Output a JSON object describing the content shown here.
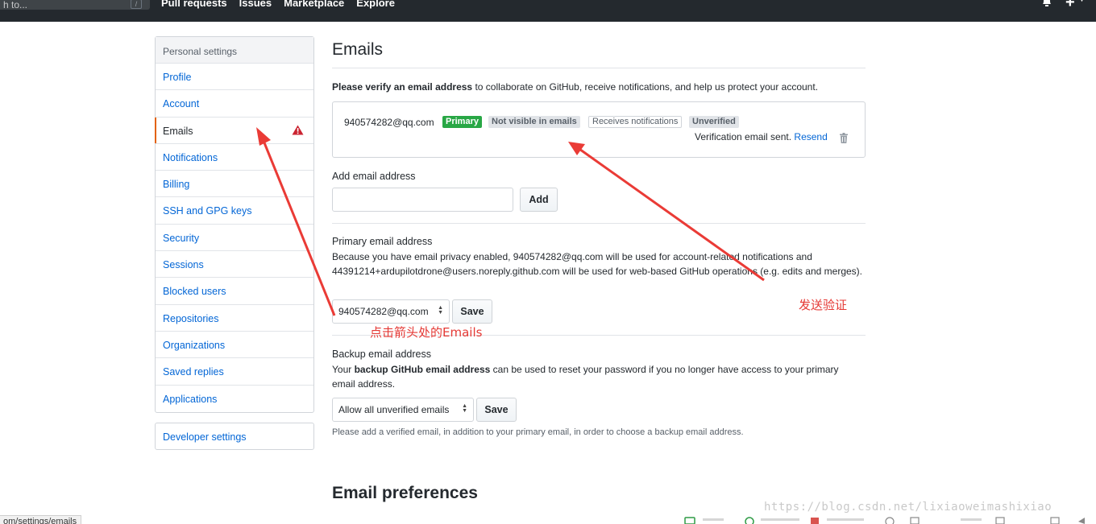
{
  "header": {
    "search_placeholder": "h to...",
    "slash_key": "/",
    "nav": [
      "Pull requests",
      "Issues",
      "Marketplace",
      "Explore"
    ]
  },
  "sidebar": {
    "heading": "Personal settings",
    "items": [
      {
        "label": "Profile"
      },
      {
        "label": "Account"
      },
      {
        "label": "Emails"
      },
      {
        "label": "Notifications"
      },
      {
        "label": "Billing"
      },
      {
        "label": "SSH and GPG keys"
      },
      {
        "label": "Security"
      },
      {
        "label": "Sessions"
      },
      {
        "label": "Blocked users"
      },
      {
        "label": "Repositories"
      },
      {
        "label": "Organizations"
      },
      {
        "label": "Saved replies"
      },
      {
        "label": "Applications"
      }
    ],
    "developer": "Developer settings"
  },
  "main": {
    "title": "Emails",
    "verify_bold": "Please verify an email address",
    "verify_rest": " to collaborate on GitHub, receive notifications, and help us protect your account.",
    "email": {
      "address": "940574282@qq.com",
      "badge_primary": "Primary",
      "badge_not_visible": "Not visible in emails",
      "badge_receives": "Receives notifications",
      "badge_unverified": "Unverified",
      "sent_text": "Verification email sent. ",
      "resend": "Resend"
    },
    "add": {
      "label": "Add email address",
      "button": "Add"
    },
    "primary": {
      "label": "Primary email address",
      "text": "Because you have email privacy enabled, 940574282@qq.com will be used for account-related notifications and 44391214+ardupilotdrone@users.noreply.github.com will be used for web-based GitHub operations (e.g. edits and merges).",
      "selected": "940574282@qq.com",
      "save": "Save"
    },
    "backup": {
      "label": "Backup email address",
      "text_pre": "Your ",
      "text_bold": "backup GitHub email address",
      "text_post": " can be used to reset your password if you no longer have access to your primary email address.",
      "selected": "Allow all unverified emails",
      "save": "Save",
      "note": "Please add a verified email, in addition to your primary email, in order to choose a backup email address."
    },
    "preferences_title": "Email preferences"
  },
  "annotations": {
    "click_hint": "点击箭头处的Emails",
    "send_verify": "发送验证"
  },
  "status_url": "om/settings/emails",
  "watermark": "https://blog.csdn.net/lixiaoweimashixiao",
  "colors": {
    "header_bg": "#24292e",
    "link": "#0366d6",
    "primary_badge": "#28a745",
    "active_marker": "#e36209",
    "warning": "#cb2431",
    "annotation": "#e53935"
  }
}
